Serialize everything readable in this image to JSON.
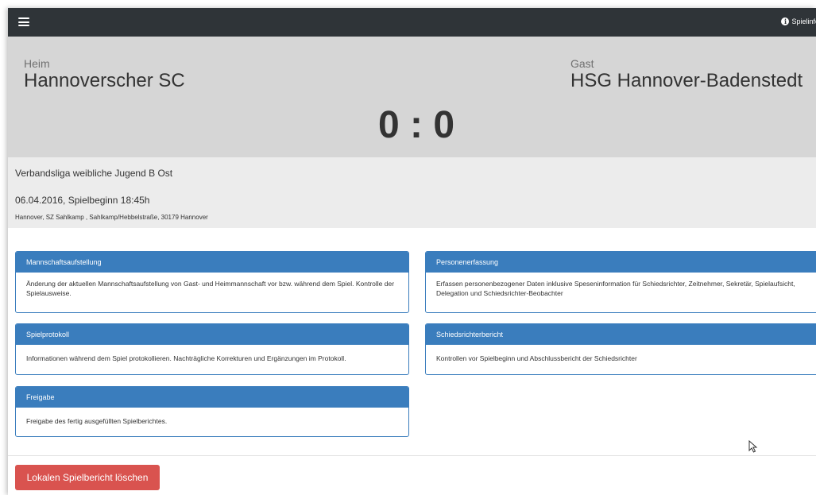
{
  "navbar": {
    "menu_icon": "hamburger-icon",
    "info_icon": "info-icon",
    "info_label": "Spielinfo"
  },
  "scoreboard": {
    "home_label": "Heim",
    "home_team": "Hannoverscher SC",
    "away_label": "Gast",
    "away_team": "HSG Hannover-Badenstedt",
    "score": "0 : 0"
  },
  "match": {
    "league": "Verbandsliga weibliche Jugend B Ost",
    "date_time": "06.04.2016, Spielbeginn 18:45h",
    "venue": "Hannover, SZ Sahlkamp , Sahlkamp/Hebbelstraße, 30179 Hannover"
  },
  "panels": [
    {
      "title": "Mannschaftsaufstellung",
      "body": "Änderung der aktuellen Mannschaftsaufstellung von Gast- und Heimmannschaft vor bzw. während dem Spiel. Kontrolle der Spielausweise."
    },
    {
      "title": "Personenerfassung",
      "body": "Erfassen personenbezogener Daten inklusive Speseninformation für Schiedsrichter, Zeitnehmer, Sekretär, Spielaufsicht, Delegation und Schiedsrichter-Beobachter"
    },
    {
      "title": "Spielprotokoll",
      "body": "Informationen während dem Spiel protokollieren. Nachträgliche Korrekturen und Ergänzungen im Protokoll."
    },
    {
      "title": "Schiedsrichterbericht",
      "body": "Kontrollen vor Spielbeginn und Abschlussbericht der Schiedsrichter"
    },
    {
      "title": "Freigabe",
      "body": "Freigabe des fertig ausgefüllten Spielberichtes."
    }
  ],
  "actions": {
    "delete_label": "Lokalen Spielbericht löschen"
  },
  "colors": {
    "navbar": "#2f3438",
    "panel_primary": "#3a7dbd",
    "danger": "#d9534f",
    "scoreboard_bg": "#d6d6d6"
  }
}
